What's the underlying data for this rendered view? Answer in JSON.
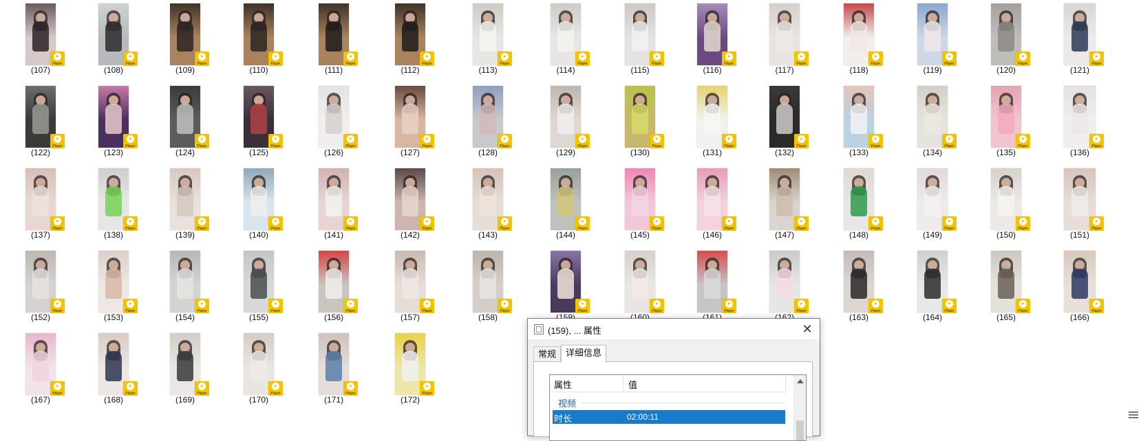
{
  "badge_text": "Player",
  "thumbnails": [
    {
      "label": "(107)",
      "bg": "#d7c8c8",
      "top": "#6c5b5e",
      "shirt": "#2b2327"
    },
    {
      "label": "(108)",
      "bg": "#b7b9bc",
      "top": "#cfd2d4",
      "shirt": "#2d2c2e"
    },
    {
      "label": "(109)",
      "bg": "#a9835d",
      "top": "#3f3229",
      "shirt": "#2b2622"
    },
    {
      "label": "(110)",
      "bg": "#a9835d",
      "top": "#3f3229",
      "shirt": "#2b2622"
    },
    {
      "label": "(111)",
      "bg": "#a9835d",
      "top": "#3f3229",
      "shirt": "#1f1c1c"
    },
    {
      "label": "(112)",
      "bg": "#a9835d",
      "top": "#3f3229",
      "shirt": "#1f1c1c"
    },
    {
      "label": "(113)",
      "bg": "#e7e6e4",
      "top": "#cfcac4",
      "shirt": "#f4f4f2"
    },
    {
      "label": "(114)",
      "bg": "#e7e6e4",
      "top": "#cfcac4",
      "shirt": "#f2f2ef"
    },
    {
      "label": "(115)",
      "bg": "#e4e3e2",
      "top": "#cbc8c5",
      "shirt": "#f1f1f0"
    },
    {
      "label": "(116)",
      "bg": "#6b4a84",
      "top": "#a78cb8",
      "shirt": "#e3d9cf"
    },
    {
      "label": "(117)",
      "bg": "#e9e4e1",
      "top": "#d6cfca",
      "shirt": "#efe9e6"
    },
    {
      "label": "(118)",
      "bg": "#f3eeee",
      "top": "#c64848",
      "shirt": "#f1e7e3"
    },
    {
      "label": "(119)",
      "bg": "#cfd7e6",
      "top": "#8aa6cf",
      "shirt": "#f1e8e7"
    },
    {
      "label": "(120)",
      "bg": "#bfbdbb",
      "top": "#a4a09e",
      "shirt": "#8d8984"
    },
    {
      "label": "(121)",
      "bg": "#eceae8",
      "top": "#d8d4d1",
      "shirt": "#2b3a55"
    },
    {
      "label": "(122)",
      "bg": "#3a3a38",
      "top": "#6b6f6e",
      "shirt": "#9a9b94"
    },
    {
      "label": "(123)",
      "bg": "#4b2f5e",
      "top": "#c77aa8",
      "shirt": "#e7c9cf"
    },
    {
      "label": "(124)",
      "bg": "#5c5c5c",
      "top": "#3b3b3b",
      "shirt": "#bfbfbf"
    },
    {
      "label": "(125)",
      "bg": "#3b2f3a",
      "top": "#6a5660",
      "shirt": "#b04248"
    },
    {
      "label": "(126)",
      "bg": "#f0efee",
      "top": "#e5e3e1",
      "shirt": "#d3d0cd"
    },
    {
      "label": "(127)",
      "bg": "#d9b6a3",
      "top": "#6a4a41",
      "shirt": "#e8d1c6"
    },
    {
      "label": "(128)",
      "bg": "#c8c9cc",
      "top": "#8fa0bf",
      "shirt": "#d2b8b8"
    },
    {
      "label": "(129)",
      "bg": "#ddd8d3",
      "top": "#bfb6ae",
      "shirt": "#f1efed"
    },
    {
      "label": "(130)",
      "bg": "#c7b76a",
      "top": "#b9c34b",
      "shirt": "#d8db6a"
    },
    {
      "label": "(131)",
      "bg": "#f1f1ef",
      "top": "#e6d36f",
      "shirt": "#f7f7f6"
    },
    {
      "label": "(132)",
      "bg": "#2b2a2a",
      "top": "#3a3938",
      "shirt": "#cfcbc8"
    },
    {
      "label": "(133)",
      "bg": "#b9d3e4",
      "top": "#e7c2b9",
      "shirt": "#f3f3f3"
    },
    {
      "label": "(134)",
      "bg": "#e6e3de",
      "top": "#d4cfc8",
      "shirt": "#ece7e0"
    },
    {
      "label": "(135)",
      "bg": "#efc5cf",
      "top": "#e7a3b4",
      "shirt": "#f2a9bf"
    },
    {
      "label": "(136)",
      "bg": "#f1eef0",
      "top": "#e5e1e3",
      "shirt": "#ebe6e9"
    },
    {
      "label": "(137)",
      "bg": "#e8d7d1",
      "top": "#d5c0b6",
      "shirt": "#eee3df"
    },
    {
      "label": "(138)",
      "bg": "#e7e6e6",
      "top": "#d0cdcc",
      "shirt": "#77d153"
    },
    {
      "label": "(139)",
      "bg": "#e9e1dd",
      "top": "#d8c8c0",
      "shirt": "#d5c7c0"
    },
    {
      "label": "(140)",
      "bg": "#d8e5ee",
      "top": "#8fa9b7",
      "shirt": "#efefef"
    },
    {
      "label": "(141)",
      "bg": "#e8d4d4",
      "top": "#d1b2b2",
      "shirt": "#f2f2f2"
    },
    {
      "label": "(142)",
      "bg": "#cdb5ae",
      "top": "#5b4a48",
      "shirt": "#e8d6d1"
    },
    {
      "label": "(143)",
      "bg": "#e6ddd6",
      "top": "#d4c3b8",
      "shirt": "#f0e5dd"
    },
    {
      "label": "(144)",
      "bg": "#bfc1bd",
      "top": "#9aa19a",
      "shirt": "#d3c47a"
    },
    {
      "label": "(145)",
      "bg": "#f2c7da",
      "top": "#ef86b4",
      "shirt": "#f4d3e1"
    },
    {
      "label": "(146)",
      "bg": "#f3d2dd",
      "top": "#e79bb9",
      "shirt": "#f3e3e6"
    },
    {
      "label": "(147)",
      "bg": "#d9d4cf",
      "top": "#a18a73",
      "shirt": "#cbbcad"
    },
    {
      "label": "(148)",
      "bg": "#e6e6e6",
      "top": "#e0d8d2",
      "shirt": "#2e9a4b"
    },
    {
      "label": "(149)",
      "bg": "#eeebea",
      "top": "#e0dad7",
      "shirt": "#f3f1f0"
    },
    {
      "label": "(150)",
      "bg": "#ece9e6",
      "top": "#d7d1cc",
      "shirt": "#f5f4f2"
    },
    {
      "label": "(151)",
      "bg": "#e7dcd7",
      "top": "#d5c5bd",
      "shirt": "#f1ece9"
    },
    {
      "label": "(152)",
      "bg": "#d6d2cf",
      "top": "#bdb7b2",
      "shirt": "#e8e3df"
    },
    {
      "label": "(153)",
      "bg": "#efe7e4",
      "top": "#dbcfca",
      "shirt": "#d8b7a8"
    },
    {
      "label": "(154)",
      "bg": "#d3d3d2",
      "top": "#b7b7b5",
      "shirt": "#e4e4e2"
    },
    {
      "label": "(155)",
      "bg": "#d7d9d9",
      "top": "#c2c6c6",
      "shirt": "#4a4d4f"
    },
    {
      "label": "(156)",
      "bg": "#c9c5c1",
      "top": "#d64545",
      "shirt": "#f0eeec"
    },
    {
      "label": "(157)",
      "bg": "#e7ddd8",
      "top": "#c8b9b1",
      "shirt": "#f0e8e4"
    },
    {
      "label": "(158)",
      "bg": "#d3cec9",
      "top": "#bcb5ae",
      "shirt": "#e9e5e2"
    },
    {
      "label": "(159)",
      "bg": "#4a3a5c",
      "top": "#8a74a6",
      "shirt": "#f0e4dc"
    },
    {
      "label": "(160)",
      "bg": "#e9e5e2",
      "top": "#d6cfcb",
      "shirt": "#f2e9e7"
    },
    {
      "label": "(161)",
      "bg": "#c5c5c7",
      "top": "#d84b4b",
      "shirt": "#dadadc"
    },
    {
      "label": "(162)",
      "bg": "#e6e6e6",
      "top": "#c9c9c9",
      "shirt": "#f3dbe0"
    },
    {
      "label": "(163)",
      "bg": "#dcd6d3",
      "top": "#c4bbb6",
      "shirt": "#2a2828"
    },
    {
      "label": "(164)",
      "bg": "#e8e8e8",
      "top": "#cfcfcf",
      "shirt": "#2b2b2b"
    },
    {
      "label": "(165)",
      "bg": "#e4e1dd",
      "top": "#cdc7c1",
      "shirt": "#6b6157"
    },
    {
      "label": "(166)",
      "bg": "#e8dfd8",
      "top": "#d8c8bb",
      "shirt": "#2a3a63"
    },
    {
      "label": "(167)",
      "bg": "#f1e3ea",
      "top": "#e8b7cc",
      "shirt": "#f1d4dd"
    },
    {
      "label": "(168)",
      "bg": "#ede6e2",
      "top": "#d9ccc5",
      "shirt": "#2f3550"
    },
    {
      "label": "(169)",
      "bg": "#e9e6e3",
      "top": "#d1ccc8",
      "shirt": "#3a3a3b"
    },
    {
      "label": "(170)",
      "bg": "#e9e5e0",
      "top": "#d6ccc4",
      "shirt": "#efeae5"
    },
    {
      "label": "(171)",
      "bg": "#e4ddd9",
      "top": "#cfc1ba",
      "shirt": "#5b7fa8"
    },
    {
      "label": "(172)",
      "bg": "#eee6a8",
      "top": "#e9d14a",
      "shirt": "#f1f1f1"
    }
  ],
  "dialog": {
    "title": "(159), ... 属性",
    "close_glyph": "✕",
    "tabs": [
      {
        "label": "常规",
        "active": false
      },
      {
        "label": "详细信息",
        "active": true
      }
    ],
    "table": {
      "col_property": "属性",
      "col_value": "值",
      "group": "视频",
      "selected_row": {
        "key": "时长",
        "value": "02:00:11"
      }
    }
  }
}
